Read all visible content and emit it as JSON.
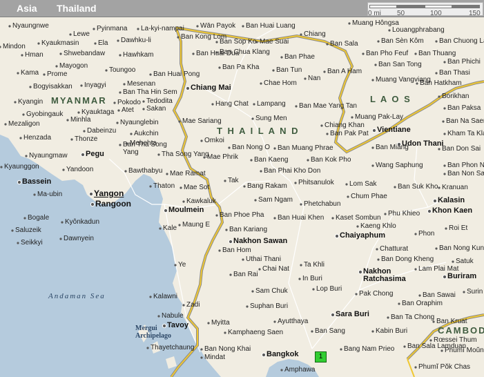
{
  "header": {
    "region": "Asia",
    "country": "Thailand"
  },
  "scale": {
    "ticks": [
      "0 mi",
      "50",
      "100",
      "150"
    ]
  },
  "marker": {
    "label": "1"
  },
  "colors": {
    "sea": "#b5cbdd",
    "land": "#f1ede2",
    "border": "#f0c832",
    "border_outline": "#8a8a8a",
    "road": "#ffffff"
  },
  "places": [
    {
      "name": "Nyaungnwe",
      "kind": "town"
    },
    {
      "name": "Lewe",
      "kind": "town"
    },
    {
      "name": "Pyinmana",
      "kind": "town"
    },
    {
      "name": "La-kyi-nampai",
      "kind": "town"
    },
    {
      "name": "Wān Payok",
      "kind": "town"
    },
    {
      "name": "Ban Huai Luang",
      "kind": "town"
    },
    {
      "name": "Chiang",
      "kind": "town"
    },
    {
      "name": "Muang Hôngsa",
      "kind": "town"
    },
    {
      "name": "Louangphrabang",
      "kind": "town"
    },
    {
      "name": "Mindon",
      "kind": "town"
    },
    {
      "name": "Kyaukmasin",
      "kind": "town"
    },
    {
      "name": "Ela",
      "kind": "town"
    },
    {
      "name": "Dawhku-li",
      "kind": "town"
    },
    {
      "name": "Ban Kong Lom",
      "kind": "town"
    },
    {
      "name": "Ban Sop Ko",
      "kind": "town"
    },
    {
      "name": "Mae Suai",
      "kind": "town"
    },
    {
      "name": "Ban Sala",
      "kind": "town"
    },
    {
      "name": "Ban Sèn Kôm",
      "kind": "town"
    },
    {
      "name": "Ban Chuong La",
      "kind": "town"
    },
    {
      "name": "Hman",
      "kind": "town"
    },
    {
      "name": "Shwebandaw",
      "kind": "town"
    },
    {
      "name": "Hawhkam",
      "kind": "town"
    },
    {
      "name": "Ban Huai Dua",
      "kind": "town"
    },
    {
      "name": "Ban Chua Klang",
      "kind": "town"
    },
    {
      "name": "Ban Phae",
      "kind": "town"
    },
    {
      "name": "Ban Pho Feuf",
      "kind": "town"
    },
    {
      "name": "Ban Thuang",
      "kind": "town"
    },
    {
      "name": "Ban Phichi",
      "kind": "town"
    },
    {
      "name": "Mayogon",
      "kind": "town"
    },
    {
      "name": "Toungoo",
      "kind": "town"
    },
    {
      "name": "Ban Pa Kha",
      "kind": "town"
    },
    {
      "name": "Ban Tun",
      "kind": "town"
    },
    {
      "name": "Ban A Ham",
      "kind": "town"
    },
    {
      "name": "Ban San Tong",
      "kind": "town"
    },
    {
      "name": "Kama",
      "kind": "town"
    },
    {
      "name": "Prome",
      "kind": "town"
    },
    {
      "name": "Ban Huai Pong",
      "kind": "town"
    },
    {
      "name": "Nan",
      "kind": "town"
    },
    {
      "name": "Muang Vangviang",
      "kind": "town"
    },
    {
      "name": "Ban Thasi",
      "kind": "town"
    },
    {
      "name": "Bogyisakkan",
      "kind": "town"
    },
    {
      "name": "Inyagyi",
      "kind": "town"
    },
    {
      "name": "Mesenan",
      "kind": "town"
    },
    {
      "name": "Chiang Mai",
      "kind": "city"
    },
    {
      "name": "Chae Hom",
      "kind": "town"
    },
    {
      "name": "Ban Hatkham",
      "kind": "town"
    },
    {
      "name": "Ban Tha Hin Sem",
      "kind": "town"
    },
    {
      "name": "Borikhan",
      "kind": "town"
    },
    {
      "name": "Kyangin",
      "kind": "town"
    },
    {
      "name": "Pokodo",
      "kind": "town"
    },
    {
      "name": "Tedodita",
      "kind": "town"
    },
    {
      "name": "Hang Chat",
      "kind": "town"
    },
    {
      "name": "Lampang",
      "kind": "town"
    },
    {
      "name": "Ban Mae Yang Tan",
      "kind": "town"
    },
    {
      "name": "L A O S",
      "kind": "country"
    },
    {
      "name": "Ban Paksa",
      "kind": "town"
    },
    {
      "name": "MYANMAR",
      "kind": "country"
    },
    {
      "name": "Gyobingauk",
      "kind": "town"
    },
    {
      "name": "Kyauktaga",
      "kind": "town"
    },
    {
      "name": "Atet",
      "kind": "town"
    },
    {
      "name": "Sakan",
      "kind": "town"
    },
    {
      "name": "Sung Men",
      "kind": "town"
    },
    {
      "name": "Muang Pak-Lay",
      "kind": "town"
    },
    {
      "name": "Ban Na Saeng",
      "kind": "town"
    },
    {
      "name": "Mezaligon",
      "kind": "town"
    },
    {
      "name": "Minhla",
      "kind": "town"
    },
    {
      "name": "Nyaunglebin",
      "kind": "town"
    },
    {
      "name": "Mae Sariang",
      "kind": "town"
    },
    {
      "name": "T H A I L A N D",
      "kind": "country"
    },
    {
      "name": "Chiang Khan",
      "kind": "town"
    },
    {
      "name": "Vientiane",
      "kind": "city"
    },
    {
      "name": "Dabeinzu",
      "kind": "town"
    },
    {
      "name": "Aukchin",
      "kind": "town"
    },
    {
      "name": "Ban Pak Pat",
      "kind": "town"
    },
    {
      "name": "Kham Ta Kla",
      "kind": "town"
    },
    {
      "name": "Henzada",
      "kind": "town"
    },
    {
      "name": "Thonze",
      "kind": "town"
    },
    {
      "name": "Mehehta",
      "kind": "town"
    },
    {
      "name": "Omkoi",
      "kind": "town"
    },
    {
      "name": "Udon Thani",
      "kind": "city"
    },
    {
      "name": "Ban Tha Song Yang",
      "kind": "town"
    },
    {
      "name": "Ban Nong O",
      "kind": "town"
    },
    {
      "name": "Ban Muang Phrae",
      "kind": "town"
    },
    {
      "name": "Ban Miang",
      "kind": "town"
    },
    {
      "name": "Ban Don Sai",
      "kind": "town"
    },
    {
      "name": "Nyaungmaw",
      "kind": "town"
    },
    {
      "name": "Pegu",
      "kind": "city"
    },
    {
      "name": "Tha Song Yang",
      "kind": "town"
    },
    {
      "name": "Mae Phrik",
      "kind": "town"
    },
    {
      "name": "Ban Kaeng",
      "kind": "town"
    },
    {
      "name": "Ban Kok Pho",
      "kind": "town"
    },
    {
      "name": "Kyaunggon",
      "kind": "town"
    },
    {
      "name": "Yandoon",
      "kind": "town"
    },
    {
      "name": "Bawthabyu",
      "kind": "town"
    },
    {
      "name": "Mae Ramat",
      "kind": "town"
    },
    {
      "name": "Ban Phai Kho Don",
      "kind": "town"
    },
    {
      "name": "Wang Saphung",
      "kind": "town"
    },
    {
      "name": "Ban Phon Ngam",
      "kind": "town"
    },
    {
      "name": "Ban Non Sa-at",
      "kind": "town"
    },
    {
      "name": "Bassein",
      "kind": "city"
    },
    {
      "name": "Thaton",
      "kind": "town"
    },
    {
      "name": "Mae Sot",
      "kind": "town"
    },
    {
      "name": "Tak",
      "kind": "town"
    },
    {
      "name": "Bang Rakam",
      "kind": "town"
    },
    {
      "name": "Phitsanulok",
      "kind": "town"
    },
    {
      "name": "Lom Sak",
      "kind": "town"
    },
    {
      "name": "Ban Suk Kho",
      "kind": "town"
    },
    {
      "name": "Kranuan",
      "kind": "town"
    },
    {
      "name": "Ma-ubin",
      "kind": "town"
    },
    {
      "name": "Yangon",
      "kind": "city"
    },
    {
      "name": "Rangoon",
      "kind": "city"
    },
    {
      "name": "Sam Ngam",
      "kind": "town"
    },
    {
      "name": "Chum Phae",
      "kind": "town"
    },
    {
      "name": "Kalasin",
      "kind": "city"
    },
    {
      "name": "Kawkaluk",
      "kind": "town"
    },
    {
      "name": "Moulmein",
      "kind": "city"
    },
    {
      "name": "Phetchabun",
      "kind": "town"
    },
    {
      "name": "Khon Kaen",
      "kind": "city"
    },
    {
      "name": "Bogale",
      "kind": "town"
    },
    {
      "name": "Ban Phoe Pha",
      "kind": "town"
    },
    {
      "name": "Ban Huai Khen",
      "kind": "town"
    },
    {
      "name": "Kaset Sombun",
      "kind": "town"
    },
    {
      "name": "Phu Khieo",
      "kind": "town"
    },
    {
      "name": "Kyônkadun",
      "kind": "town"
    },
    {
      "name": "Maung E",
      "kind": "town"
    },
    {
      "name": "Kaeng Khlo",
      "kind": "town"
    },
    {
      "name": "Roi Et",
      "kind": "town"
    },
    {
      "name": "Saluzeik",
      "kind": "town"
    },
    {
      "name": "Kale",
      "kind": "town"
    },
    {
      "name": "Ban Kariang",
      "kind": "town"
    },
    {
      "name": "Chaiyaphum",
      "kind": "city"
    },
    {
      "name": "Phon",
      "kind": "town"
    },
    {
      "name": "Seikkyi",
      "kind": "town"
    },
    {
      "name": "Dawnyein",
      "kind": "town"
    },
    {
      "name": "Nakhon Sawan",
      "kind": "city"
    },
    {
      "name": "Ban Nong Kung",
      "kind": "town"
    },
    {
      "name": "Ban Hom",
      "kind": "town"
    },
    {
      "name": "Chatturat",
      "kind": "town"
    },
    {
      "name": "Uthai Thani",
      "kind": "town"
    },
    {
      "name": "Ban Dong Kheng",
      "kind": "town"
    },
    {
      "name": "Satuk",
      "kind": "town"
    },
    {
      "name": "Ye",
      "kind": "town"
    },
    {
      "name": "Chai Nat",
      "kind": "town"
    },
    {
      "name": "Ta Khli",
      "kind": "town"
    },
    {
      "name": "Lam Plai Mat",
      "kind": "town"
    },
    {
      "name": "Ban Rai",
      "kind": "town"
    },
    {
      "name": "Nakhon Ratchasima",
      "kind": "city"
    },
    {
      "name": "Buriram",
      "kind": "city"
    },
    {
      "name": "In Buri",
      "kind": "town"
    },
    {
      "name": "Andaman Sea",
      "kind": "water"
    },
    {
      "name": "Kalawni",
      "kind": "town"
    },
    {
      "name": "Sam Chuk",
      "kind": "town"
    },
    {
      "name": "Lop Buri",
      "kind": "town"
    },
    {
      "name": "Pak Chong",
      "kind": "town"
    },
    {
      "name": "Ban Sawai",
      "kind": "town"
    },
    {
      "name": "Surin",
      "kind": "town"
    },
    {
      "name": "Zadi",
      "kind": "town"
    },
    {
      "name": "Suphan Buri",
      "kind": "town"
    },
    {
      "name": "Ban Oraphim",
      "kind": "town"
    },
    {
      "name": "Nabule",
      "kind": "town"
    },
    {
      "name": "Sara Buri",
      "kind": "city"
    },
    {
      "name": "Ban Ta Chong",
      "kind": "town"
    },
    {
      "name": "Ban Kruat",
      "kind": "town"
    },
    {
      "name": "Mergui Archipelago",
      "kind": "island"
    },
    {
      "name": "Tavoy",
      "kind": "city"
    },
    {
      "name": "Myitta",
      "kind": "town"
    },
    {
      "name": "Ayutthaya",
      "kind": "town"
    },
    {
      "name": "CAMBODIA",
      "kind": "country"
    },
    {
      "name": "Kamphaeng Saen",
      "kind": "town"
    },
    {
      "name": "Ban Sang",
      "kind": "town"
    },
    {
      "name": "Kabin Buri",
      "kind": "town"
    },
    {
      "name": "Rœssei Thum",
      "kind": "town"
    },
    {
      "name": "Thayetchaung",
      "kind": "town"
    },
    {
      "name": "Ban Nong Khai",
      "kind": "town"
    },
    {
      "name": "Ban Sala Lamduan",
      "kind": "town"
    },
    {
      "name": "Phumĭ Moŭng",
      "kind": "town"
    },
    {
      "name": "Mindat",
      "kind": "town"
    },
    {
      "name": "Bangkok",
      "kind": "city"
    },
    {
      "name": "Bang Nam Prieo",
      "kind": "town"
    },
    {
      "name": "Amphawa",
      "kind": "town"
    },
    {
      "name": "Phumĭ Pŏk Chas",
      "kind": "town"
    }
  ]
}
